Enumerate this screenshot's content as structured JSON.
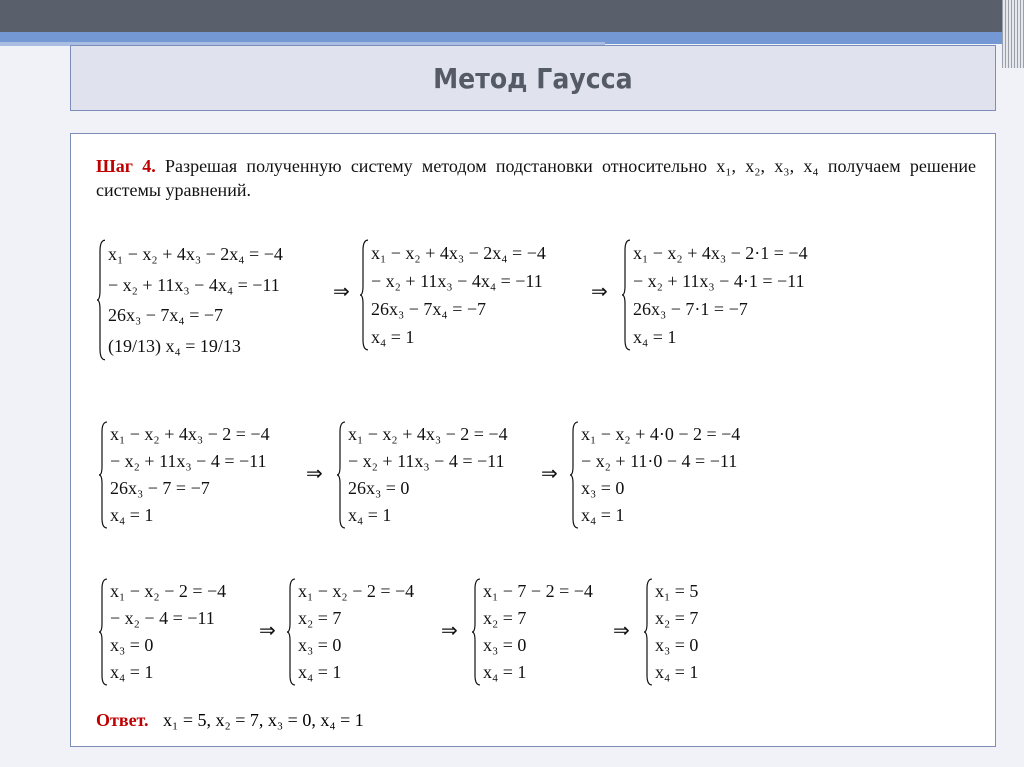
{
  "title": "Метод Гаусса",
  "intro": {
    "step": "Шаг 4.",
    "text": " Разрешая полученную систему методом подстановки относительно x₁, x₂, x₃, x₄ получаем решение системы уравнений."
  },
  "rows": [
    {
      "systems": [
        [
          "x₁ − x₂ + 4x₃ − 2x₄ = −4",
          "− x₂ + 11x₃ − 4x₄ = −11",
          "26x₃ − 7x₄ = −7",
          "(19/13) x₄ = 19/13"
        ],
        [
          "x₁ − x₂ + 4x₃ − 2x₄ = −4",
          "− x₂ + 11x₃ − 4x₄ = −11",
          "26x₃ − 7x₄ = −7",
          "x₄ = 1"
        ],
        [
          "x₁ − x₂ + 4x₃ − 2·1 = −4",
          "− x₂ + 11x₃ − 4·1 = −11",
          "26x₃ − 7·1 = −7",
          "x₄ = 1"
        ]
      ]
    },
    {
      "systems": [
        [
          "x₁ − x₂ + 4x₃ − 2 = −4",
          "− x₂ + 11x₃ − 4 = −11",
          "26x₃ − 7 = −7",
          "x₄ = 1"
        ],
        [
          "x₁ − x₂ + 4x₃ − 2 = −4",
          "− x₂ + 11x₃ − 4 = −11",
          "26x₃ = 0",
          "x₄ = 1"
        ],
        [
          "x₁ − x₂ + 4·0 − 2 = −4",
          "− x₂ + 11·0 − 4 = −11",
          "x₃ = 0",
          "x₄ = 1"
        ]
      ]
    },
    {
      "systems": [
        [
          "x₁ − x₂ − 2 = −4",
          "− x₂ − 4 = −11",
          "x₃ = 0",
          "x₄ = 1"
        ],
        [
          "x₁ − x₂ − 2 = −4",
          "x₂ = 7",
          "x₃ = 0",
          "x₄ = 1"
        ],
        [
          "x₁ − 7 − 2 = −4",
          "x₂ = 7",
          "x₃ = 0",
          "x₄ = 1"
        ],
        [
          "x₁ = 5",
          "x₂ = 7",
          "x₃ = 0",
          "x₄ = 1"
        ]
      ]
    }
  ],
  "arrow": "⇒",
  "answer": {
    "label": "Ответ.",
    "text": "x₁ = 5,  x₂ = 7,  x₃ = 0,  x₄ = 1"
  }
}
